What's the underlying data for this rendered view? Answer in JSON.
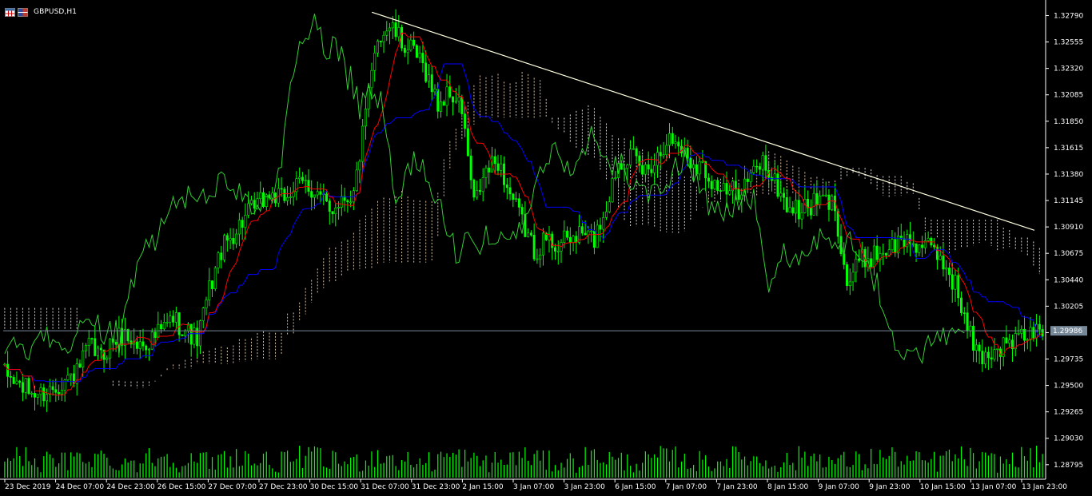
{
  "window": {
    "symbol_title": "GBPUSD,H1"
  },
  "icons": [
    "chart-table-icon",
    "chart-flag-icon"
  ],
  "colors": {
    "background": "#000000",
    "candle": "#00ff00",
    "tenkan": "#ff0000",
    "kijun": "#0000ff",
    "chikou": "#32cd32",
    "cloud_bull": "#ffe4c4",
    "cloud_bear": "#ffffff",
    "trendline": "#ffffe0",
    "price_line": "#778899",
    "axis_text": "#ffffff",
    "volume": "#00ff00"
  },
  "chart_data": {
    "type": "candlestick",
    "title": "GBPUSD,H1",
    "indicators": [
      "Ichimoku Kinko Hyo",
      "Volumes"
    ],
    "ylim": [
      1.2868,
      1.329
    ],
    "y_ticks": [
      "1.32790",
      "1.32555",
      "1.32320",
      "1.32085",
      "1.31850",
      "1.31615",
      "1.31380",
      "1.31145",
      "1.30910",
      "1.30675",
      "1.30440",
      "1.30205",
      "1.29970",
      "1.29735",
      "1.29500",
      "1.29265",
      "1.29030",
      "1.28795"
    ],
    "current_price": "1.29986",
    "x_ticks": [
      "23 Dec 2019",
      "24 Dec 07:00",
      "24 Dec 23:00",
      "26 Dec 15:00",
      "27 Dec 07:00",
      "27 Dec 23:00",
      "30 Dec 15:00",
      "31 Dec 07:00",
      "31 Dec 23:00",
      "2 Jan 15:00",
      "3 Jan 07:00",
      "3 Jan 23:00",
      "6 Jan 15:00",
      "7 Jan 07:00",
      "7 Jan 23:00",
      "8 Jan 15:00",
      "9 Jan 07:00",
      "9 Jan 23:00",
      "10 Jan 15:00",
      "13 Jan 07:00",
      "13 Jan 23:00"
    ],
    "close_path": [
      [
        0,
        1.296
      ],
      [
        4,
        1.2952
      ],
      [
        8,
        1.2945
      ],
      [
        12,
        1.2942
      ],
      [
        16,
        1.2948
      ],
      [
        20,
        1.2955
      ],
      [
        24,
        1.296
      ],
      [
        28,
        1.2985
      ],
      [
        32,
        1.2975
      ],
      [
        36,
        1.299
      ],
      [
        40,
        1.2995
      ],
      [
        44,
        1.2985
      ],
      [
        48,
        1.299
      ],
      [
        52,
        1.2998
      ],
      [
        56,
        1.301
      ],
      [
        60,
        1.3
      ],
      [
        64,
        1.299
      ],
      [
        68,
        1.3035
      ],
      [
        72,
        1.307
      ],
      [
        76,
        1.3085
      ],
      [
        80,
        1.31
      ],
      [
        84,
        1.311
      ],
      [
        88,
        1.312
      ],
      [
        92,
        1.3115
      ],
      [
        96,
        1.3125
      ],
      [
        100,
        1.313
      ],
      [
        104,
        1.312
      ],
      [
        108,
        1.3105
      ],
      [
        112,
        1.3118
      ],
      [
        116,
        1.312
      ],
      [
        120,
        1.319
      ],
      [
        124,
        1.326
      ],
      [
        128,
        1.327
      ],
      [
        132,
        1.3255
      ],
      [
        136,
        1.3245
      ],
      [
        140,
        1.323
      ],
      [
        144,
        1.32
      ],
      [
        148,
        1.321
      ],
      [
        152,
        1.3195
      ],
      [
        156,
        1.311
      ],
      [
        160,
        1.314
      ],
      [
        164,
        1.315
      ],
      [
        168,
        1.312
      ],
      [
        172,
        1.3095
      ],
      [
        176,
        1.307
      ],
      [
        180,
        1.308
      ],
      [
        184,
        1.3075
      ],
      [
        188,
        1.308
      ],
      [
        192,
        1.3085
      ],
      [
        196,
        1.308
      ],
      [
        200,
        1.311
      ],
      [
        204,
        1.315
      ],
      [
        208,
        1.3155
      ],
      [
        212,
        1.314
      ],
      [
        216,
        1.315
      ],
      [
        220,
        1.317
      ],
      [
        224,
        1.3165
      ],
      [
        228,
        1.315
      ],
      [
        232,
        1.3145
      ],
      [
        236,
        1.313
      ],
      [
        240,
        1.312
      ],
      [
        244,
        1.3125
      ],
      [
        248,
        1.3135
      ],
      [
        252,
        1.315
      ],
      [
        256,
        1.313
      ],
      [
        260,
        1.311
      ],
      [
        264,
        1.3105
      ],
      [
        268,
        1.311
      ],
      [
        272,
        1.3115
      ],
      [
        276,
        1.311
      ],
      [
        280,
        1.304
      ],
      [
        284,
        1.306
      ],
      [
        288,
        1.3065
      ],
      [
        292,
        1.307
      ],
      [
        296,
        1.3075
      ],
      [
        300,
        1.308
      ],
      [
        304,
        1.3075
      ],
      [
        308,
        1.307
      ],
      [
        312,
        1.306
      ],
      [
        316,
        1.304
      ],
      [
        320,
        1.3
      ],
      [
        324,
        1.2975
      ],
      [
        328,
        1.298
      ],
      [
        332,
        1.2985
      ],
      [
        336,
        1.299
      ],
      [
        340,
        1.2995
      ],
      [
        344,
        1.2998
      ]
    ],
    "trendline": {
      "from": [
        "31 Dec 07:00",
        1.3282
      ],
      "to": [
        "13 Jan 23:00",
        1.3088
      ]
    },
    "volume": "per-bar histogram"
  }
}
